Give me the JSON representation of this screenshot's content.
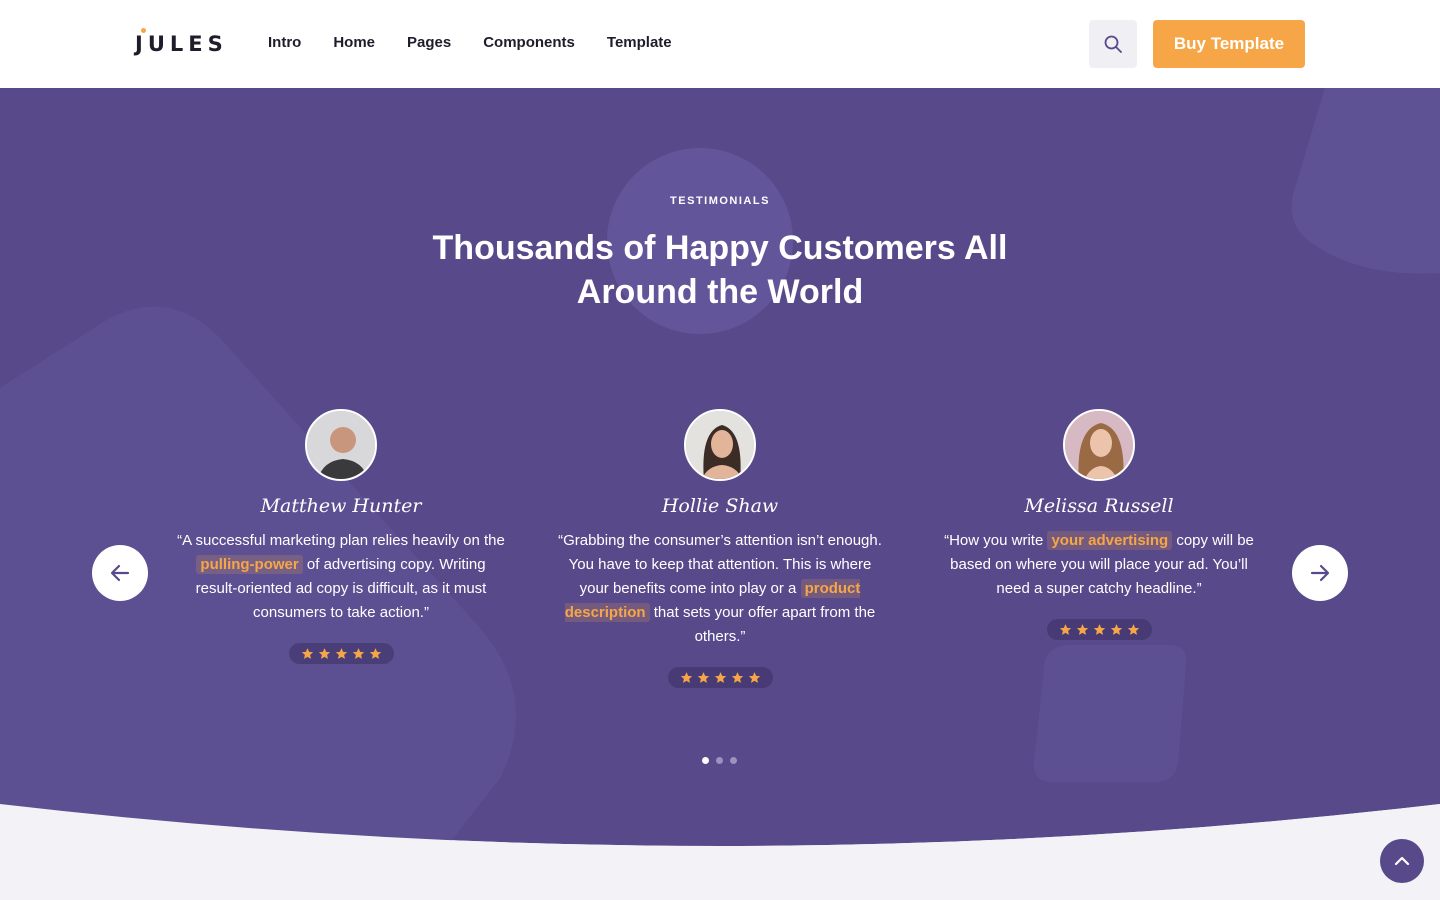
{
  "brand": {
    "logo_text": "JULES"
  },
  "nav": {
    "items": [
      "Intro",
      "Home",
      "Pages",
      "Components",
      "Template"
    ]
  },
  "header": {
    "buy_label": "Buy Template"
  },
  "section": {
    "eyebrow": "TESTIMONIALS",
    "title": "Thousands of Happy Customers All Around the World"
  },
  "testimonials": [
    {
      "name": "Matthew Hunter",
      "quote_before": "“A successful marketing plan relies heavily on the ",
      "highlight": "pulling-power",
      "quote_after": " of advertising copy. Writing result-oriented ad copy is difficult, as it must consumers to take action.”",
      "rating": 5
    },
    {
      "name": "Hollie Shaw",
      "quote_before": "“Grabbing the consumer’s attention isn’t enough. You have to keep that attention. This is where your benefits come into play or a ",
      "highlight": "product description",
      "quote_after": " that sets your offer apart from the others.”",
      "rating": 5
    },
    {
      "name": "Melissa Russell",
      "quote_before": "“How you write ",
      "highlight": "your advertising",
      "quote_after": " copy will be based on where you will place your ad. You’ll need a super catchy headline.”",
      "rating": 5
    }
  ],
  "carousel": {
    "active_index": 0,
    "page_count": 3
  },
  "colors": {
    "brand_purple": "#584a8a",
    "accent_orange": "#f6a646",
    "highlight_text": "#f6a646",
    "star": "#f6a646",
    "page_bg": "#f3f2f7"
  },
  "icons": {
    "search": "search-icon",
    "prev": "arrow-left-icon",
    "next": "arrow-right-icon",
    "scroll_top": "chevron-up-icon",
    "star": "star-icon"
  }
}
